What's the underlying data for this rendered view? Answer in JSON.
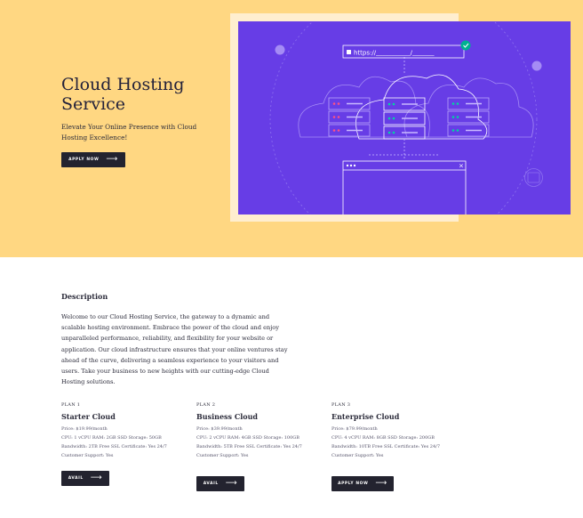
{
  "hero": {
    "title": "Cloud Hosting Service",
    "subtitle": "Elevate Your Online Presence with Cloud Hosting Excellence!",
    "button_label": "APPLY NOW",
    "url_text": "https://___________/_______"
  },
  "description": {
    "title": "Description",
    "body": "Welcome to our Cloud Hosting Service, the gateway to a dynamic and scalable hosting environment. Embrace the power of the cloud and enjoy unparalleled performance, reliability, and flexibility for your website or application. Our cloud infrastructure ensures that your online ventures stay ahead of the curve, delivering a seamless experience to your visitors and users. Take your business to new heights with our cutting-edge Cloud Hosting solutions."
  },
  "plans": [
    {
      "number": "PLAN 1",
      "name": "Starter Cloud",
      "line1": "Price: $19.99/month",
      "line2": "CPU: 1 vCPU RAM: 2GB SSD Storage: 50GB",
      "line3": "Bandwidth: 2TB Free SSL Certificate: Yes 24/7",
      "line4": "Customer Support: Yes",
      "button_label": "AVAIL"
    },
    {
      "number": "PLAN 2",
      "name": "Business Cloud",
      "line1": "Price: $39.99/month",
      "line2": "CPU: 2 vCPU RAM: 4GB SSD Storage: 100GB",
      "line3": "Bandwidth: 5TB Free SSL Certificate: Yes 24/7",
      "line4": "Customer Support: Yes",
      "button_label": "AVAIL"
    },
    {
      "number": "PLAN 3",
      "name": "Enterprise Cloud",
      "line1": "Price: $79.99/month",
      "line2": "CPU: 4 vCPU RAM: 8GB SSD Storage: 200GB",
      "line3": "Bandwidth: 10TB Free SSL Certificate: Yes 24/7",
      "line4": "Customer Support: Yes",
      "button_label": "APPLY NOW"
    }
  ],
  "colors": {
    "hero_background": "#ffd782",
    "illustration_background": "#673de6",
    "button_background": "#23232f",
    "text": "#2b2b3a"
  },
  "icons": [
    "arrow-right-icon",
    "lock-icon",
    "check-icon",
    "cloud-icon",
    "server-icon",
    "browser-window-icon"
  ]
}
